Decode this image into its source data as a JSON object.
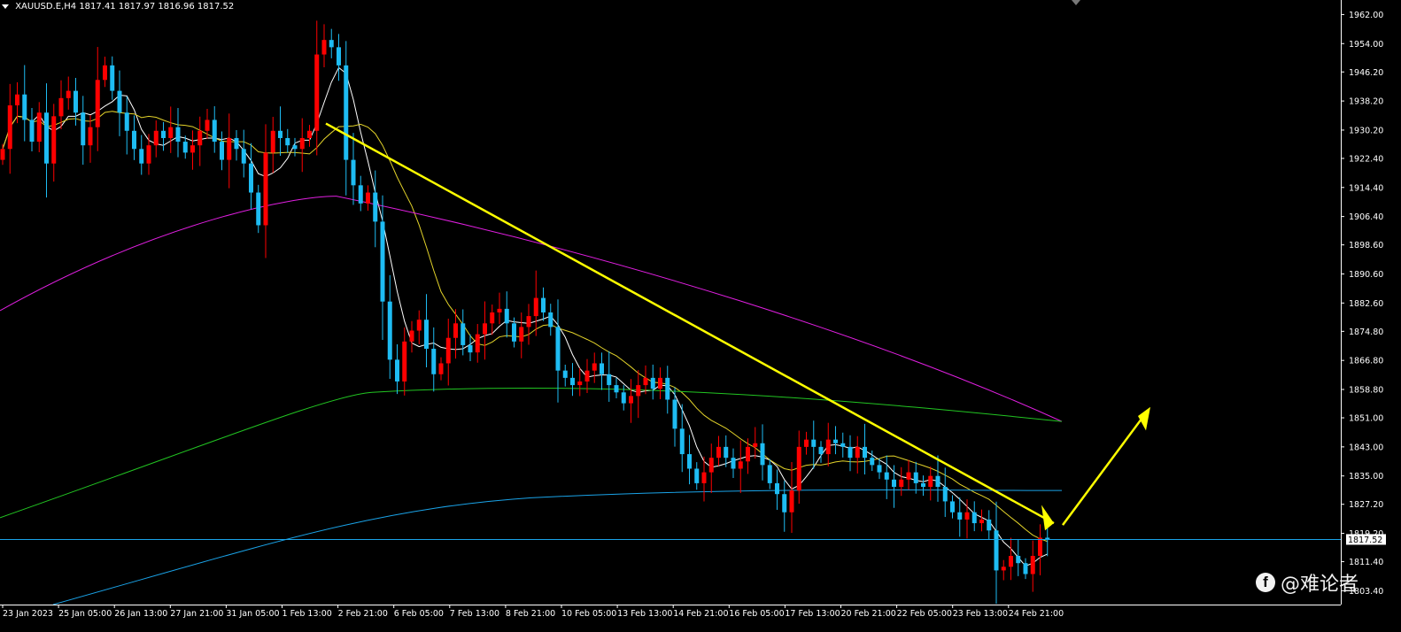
{
  "header": {
    "symbol": "XAUUSD.E,H4",
    "ohlc": "1817.41 1817.97 1816.96 1817.52"
  },
  "watermark": {
    "icon": "facebook-icon",
    "text": "@难论者"
  },
  "chart_data": {
    "type": "candlestick",
    "title": "",
    "ylim": [
      1799.6,
      1966.0
    ],
    "y_ticks": [
      1962.0,
      1954.0,
      1946.2,
      1938.2,
      1930.2,
      1922.4,
      1914.4,
      1906.4,
      1898.6,
      1890.6,
      1882.6,
      1874.8,
      1866.8,
      1858.8,
      1851.0,
      1843.0,
      1835.0,
      1827.2,
      1819.2,
      1811.4,
      1803.4
    ],
    "x_ticks": [
      "23 Jan 2023",
      "25 Jan 05:00",
      "26 Jan 13:00",
      "27 Jan 21:00",
      "31 Jan 05:00",
      "1 Feb 13:00",
      "2 Feb 21:00",
      "6 Feb 05:00",
      "7 Feb 13:00",
      "8 Feb 21:00",
      "10 Feb 05:00",
      "13 Feb 13:00",
      "14 Feb 21:00",
      "16 Feb 05:00",
      "17 Feb 13:00",
      "20 Feb 21:00",
      "22 Feb 05:00",
      "23 Feb 13:00",
      "24 Feb 21:00"
    ],
    "current_price": 1817.52,
    "current_price_label": "1817.52",
    "colors": {
      "bull": "#ff0000",
      "bear": "#1ebcf3",
      "ma_fast": "#ffffff",
      "ma_mid": "#e3d32a",
      "ma_slow": "#e01fe0",
      "ma_green": "#22c522",
      "ma_blue": "#1aa3e8",
      "trendline": "#ffff00",
      "axis": "#ffffff"
    },
    "closes": [
      1925,
      1937,
      1940,
      1933,
      1927,
      1935,
      1921,
      1934,
      1939,
      1941,
      1935,
      1926,
      1931,
      1944,
      1948,
      1941,
      1935,
      1930,
      1925,
      1921,
      1926,
      1930,
      1928,
      1931,
      1927,
      1924,
      1926,
      1930,
      1933,
      1927,
      1922,
      1928,
      1925,
      1921,
      1913,
      1904,
      1924,
      1930,
      1928,
      1926,
      1925,
      1928,
      1930,
      1951,
      1955,
      1953,
      1948,
      1922,
      1915,
      1910,
      1913,
      1905,
      1883,
      1867,
      1861,
      1872,
      1875,
      1878,
      1870,
      1863,
      1866,
      1873,
      1877,
      1871,
      1869,
      1874,
      1877,
      1880,
      1881,
      1877,
      1872,
      1876,
      1879,
      1884,
      1880,
      1876,
      1864,
      1862,
      1860,
      1861,
      1864,
      1866,
      1863,
      1860,
      1858,
      1855,
      1857,
      1860,
      1862,
      1859,
      1862,
      1856,
      1848,
      1841,
      1837,
      1833,
      1836,
      1840,
      1843,
      1840,
      1837,
      1839,
      1843,
      1844,
      1838,
      1833,
      1830,
      1825,
      1831,
      1843,
      1845,
      1843,
      1841,
      1845,
      1844,
      1843,
      1840,
      1843,
      1840,
      1838,
      1836,
      1834,
      1832,
      1834,
      1836,
      1833,
      1832,
      1835,
      1832,
      1828,
      1825,
      1823,
      1825,
      1822,
      1823,
      1820,
      1809,
      1810,
      1813,
      1811,
      1808,
      1813,
      1818,
      1817.5
    ]
  }
}
